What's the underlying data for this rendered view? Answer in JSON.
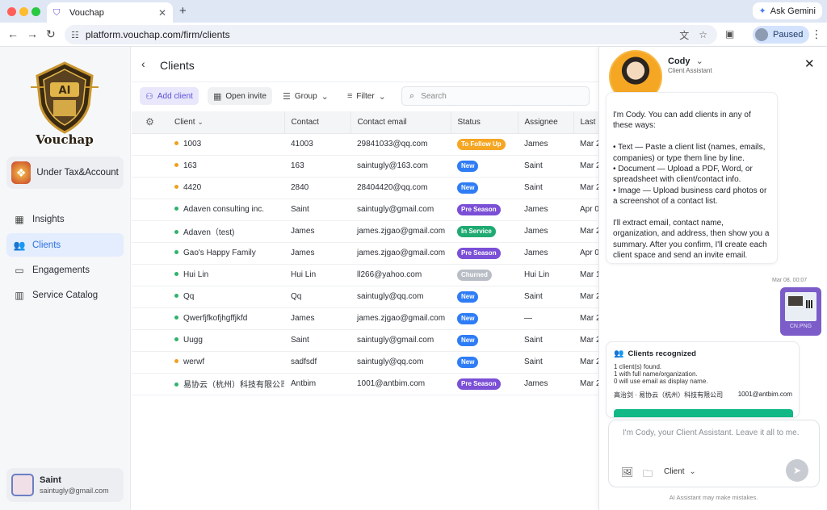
{
  "browser": {
    "tab_title": "Vouchap",
    "url": "platform.vouchap.com/firm/clients",
    "gemini_label": "Ask Gemini",
    "profile_status": "Paused"
  },
  "sidebar": {
    "brand": "Vouchap",
    "logo_text": "AI",
    "org_name": "Under Tax&Accounting",
    "nav": [
      {
        "label": "Insights",
        "icon": "chart-icon"
      },
      {
        "label": "Clients",
        "icon": "users-icon",
        "active": true
      },
      {
        "label": "Engagements",
        "icon": "briefcase-icon"
      },
      {
        "label": "Service Catalog",
        "icon": "catalog-icon"
      }
    ],
    "user": {
      "name": "Saint",
      "email": "saintugly@gmail.com"
    }
  },
  "main": {
    "title": "Clients",
    "toolbar": {
      "add_client": "Add client",
      "open_invite": "Open invite",
      "group": "Group",
      "filter": "Filter",
      "search_placeholder": "Search"
    },
    "columns": [
      "Client",
      "Contact",
      "Contact email",
      "Status",
      "Assignee",
      "Last"
    ],
    "rows": [
      {
        "client": "1003",
        "dot": "#f0a020",
        "contact": "41003",
        "email": "29841033@qq.com",
        "status": "To Follow Up",
        "status_color": "#f5a623",
        "assignee": "James",
        "last": "Mar 2"
      },
      {
        "client": "163",
        "dot": "#f0a020",
        "contact": "163",
        "email": "saintugly@163.com",
        "status": "New",
        "status_color": "#2f7df6",
        "assignee": "Saint",
        "last": "Mar 2"
      },
      {
        "client": "4420",
        "dot": "#f0a020",
        "contact": "2840",
        "email": "28404420@qq.com",
        "status": "New",
        "status_color": "#2f7df6",
        "assignee": "Saint",
        "last": "Mar 2"
      },
      {
        "client": "Adaven consulting inc.",
        "dot": "#2fb36d",
        "contact": "Saint",
        "email": "saintugly@gmail.com",
        "status": "Pre Season",
        "status_color": "#7b4fd6",
        "assignee": "James",
        "last": "Apr 0"
      },
      {
        "client": "Adaven（test)",
        "dot": "#2fb36d",
        "contact": "James",
        "email": "james.zjgao@gmail.com",
        "status": "In Service",
        "status_color": "#1faa72",
        "assignee": "James",
        "last": "Mar 2"
      },
      {
        "client": "Gao's Happy Family",
        "dot": "#2fb36d",
        "contact": "James",
        "email": "james.zjgao@gmail.com",
        "status": "Pre Season",
        "status_color": "#7b4fd6",
        "assignee": "James",
        "last": "Apr 0"
      },
      {
        "client": "Hui Lin",
        "dot": "#2fb36d",
        "contact": "Hui Lin",
        "email": "ll266@yahoo.com",
        "status": "Churned",
        "status_color": "#b9bec6",
        "assignee": "Hui Lin",
        "last": "Mar 1"
      },
      {
        "client": "Qq",
        "dot": "#2fb36d",
        "contact": "Qq",
        "email": "saintugly@qq.com",
        "status": "New",
        "status_color": "#2f7df6",
        "assignee": "Saint",
        "last": "Mar 2"
      },
      {
        "client": "Qwerfjfkofjhgffjkfd",
        "dot": "#2fb36d",
        "contact": "James",
        "email": "james.zjgao@gmail.com",
        "status": "New",
        "status_color": "#2f7df6",
        "assignee": "—",
        "last": "Mar 2"
      },
      {
        "client": "Uugg",
        "dot": "#2fb36d",
        "contact": "Saint",
        "email": "saintugly@gmail.com",
        "status": "New",
        "status_color": "#2f7df6",
        "assignee": "Saint",
        "last": "Mar 2"
      },
      {
        "client": "werwf",
        "dot": "#f0a020",
        "contact": "sadfsdf",
        "email": "saintugly@qq.com",
        "status": "New",
        "status_color": "#2f7df6",
        "assignee": "Saint",
        "last": "Mar 2"
      },
      {
        "client": "易协云（杭州）科技有限公司",
        "dot": "#2fb36d",
        "contact": "Antbim",
        "email": "1001@antbim.com",
        "status": "Pre Season",
        "status_color": "#7b4fd6",
        "assignee": "James",
        "last": "Mar 2"
      }
    ]
  },
  "assistant": {
    "name": "Cody",
    "role": "Client Assistant",
    "welcome": "I'm Cody. You can add clients in any of these ways:\n\n• Text — Paste a client list (names, emails, companies) or type them line by line.\n• Document — Upload a PDF, Word, or spreadsheet with client/contact info.\n• Image — Upload business card photos or a screenshot of a contact list.\n\nI'll extract email, contact name, organization, and address, then show you a summary. After you confirm, I'll create each client space and send an invite email.",
    "timestamp": "Mar 08, 00:07",
    "attachment_name": "CN.PNG",
    "recognized": {
      "title": "Clients recognized",
      "lines": [
        "1 client(s) found.",
        "1 with full name/organization.",
        "0 will use email as display name."
      ],
      "row_name": "高治剑 · 易协云（杭州）科技有限公司",
      "row_email": "1001@antbim.com"
    },
    "composer_placeholder": "I'm Cody, your Client Assistant. Leave it all to me.",
    "client_type": "Client",
    "disclaimer": "AI Assistant may make mistakes."
  }
}
